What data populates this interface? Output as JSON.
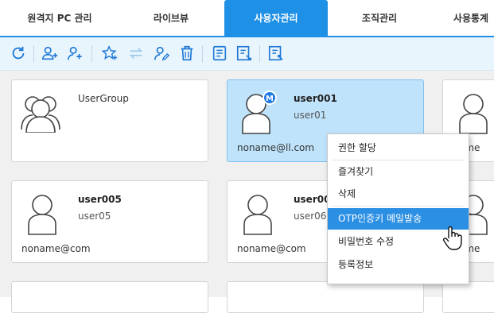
{
  "tabs": [
    {
      "label": "원격지 PC 관리"
    },
    {
      "label": "라이브뷰"
    },
    {
      "label": "사용자관리"
    },
    {
      "label": "조직관리"
    },
    {
      "label": "사용통계"
    }
  ],
  "toolbar": {
    "icons": [
      "refresh-icon",
      "add-group-icon",
      "add-user-icon",
      "add-favorite-icon",
      "move-icon",
      "edit-user-icon",
      "delete-icon",
      "list-icon",
      "export-icon",
      "import-icon"
    ]
  },
  "cards": [
    {
      "name": "UserGroup",
      "id": "",
      "email": ""
    },
    {
      "name": "user001",
      "id": "user01",
      "email": "noname@ll.com",
      "badge": "M"
    },
    {
      "name": "user005",
      "id": "user05",
      "email": "noname@com"
    },
    {
      "name": "user00",
      "id": "user06",
      "email": "noname@com"
    },
    {
      "partial_email_1": "ame",
      "partial_email_2": "ame"
    }
  ],
  "context_menu": {
    "items": [
      {
        "label": "권한 할당"
      },
      {
        "label": "즐겨찾기"
      },
      {
        "label": "삭제"
      },
      {
        "label": "OTP인증키 메일발송"
      },
      {
        "label": "비밀번호 수정"
      },
      {
        "label": "등록정보"
      }
    ],
    "highlighted_index": 3
  },
  "colors": {
    "accent": "#1e90e6",
    "selected_card": "#bfe3fb",
    "menu_highlight": "#2b8fe3",
    "toolbar_bg": "#e9f5fc"
  }
}
